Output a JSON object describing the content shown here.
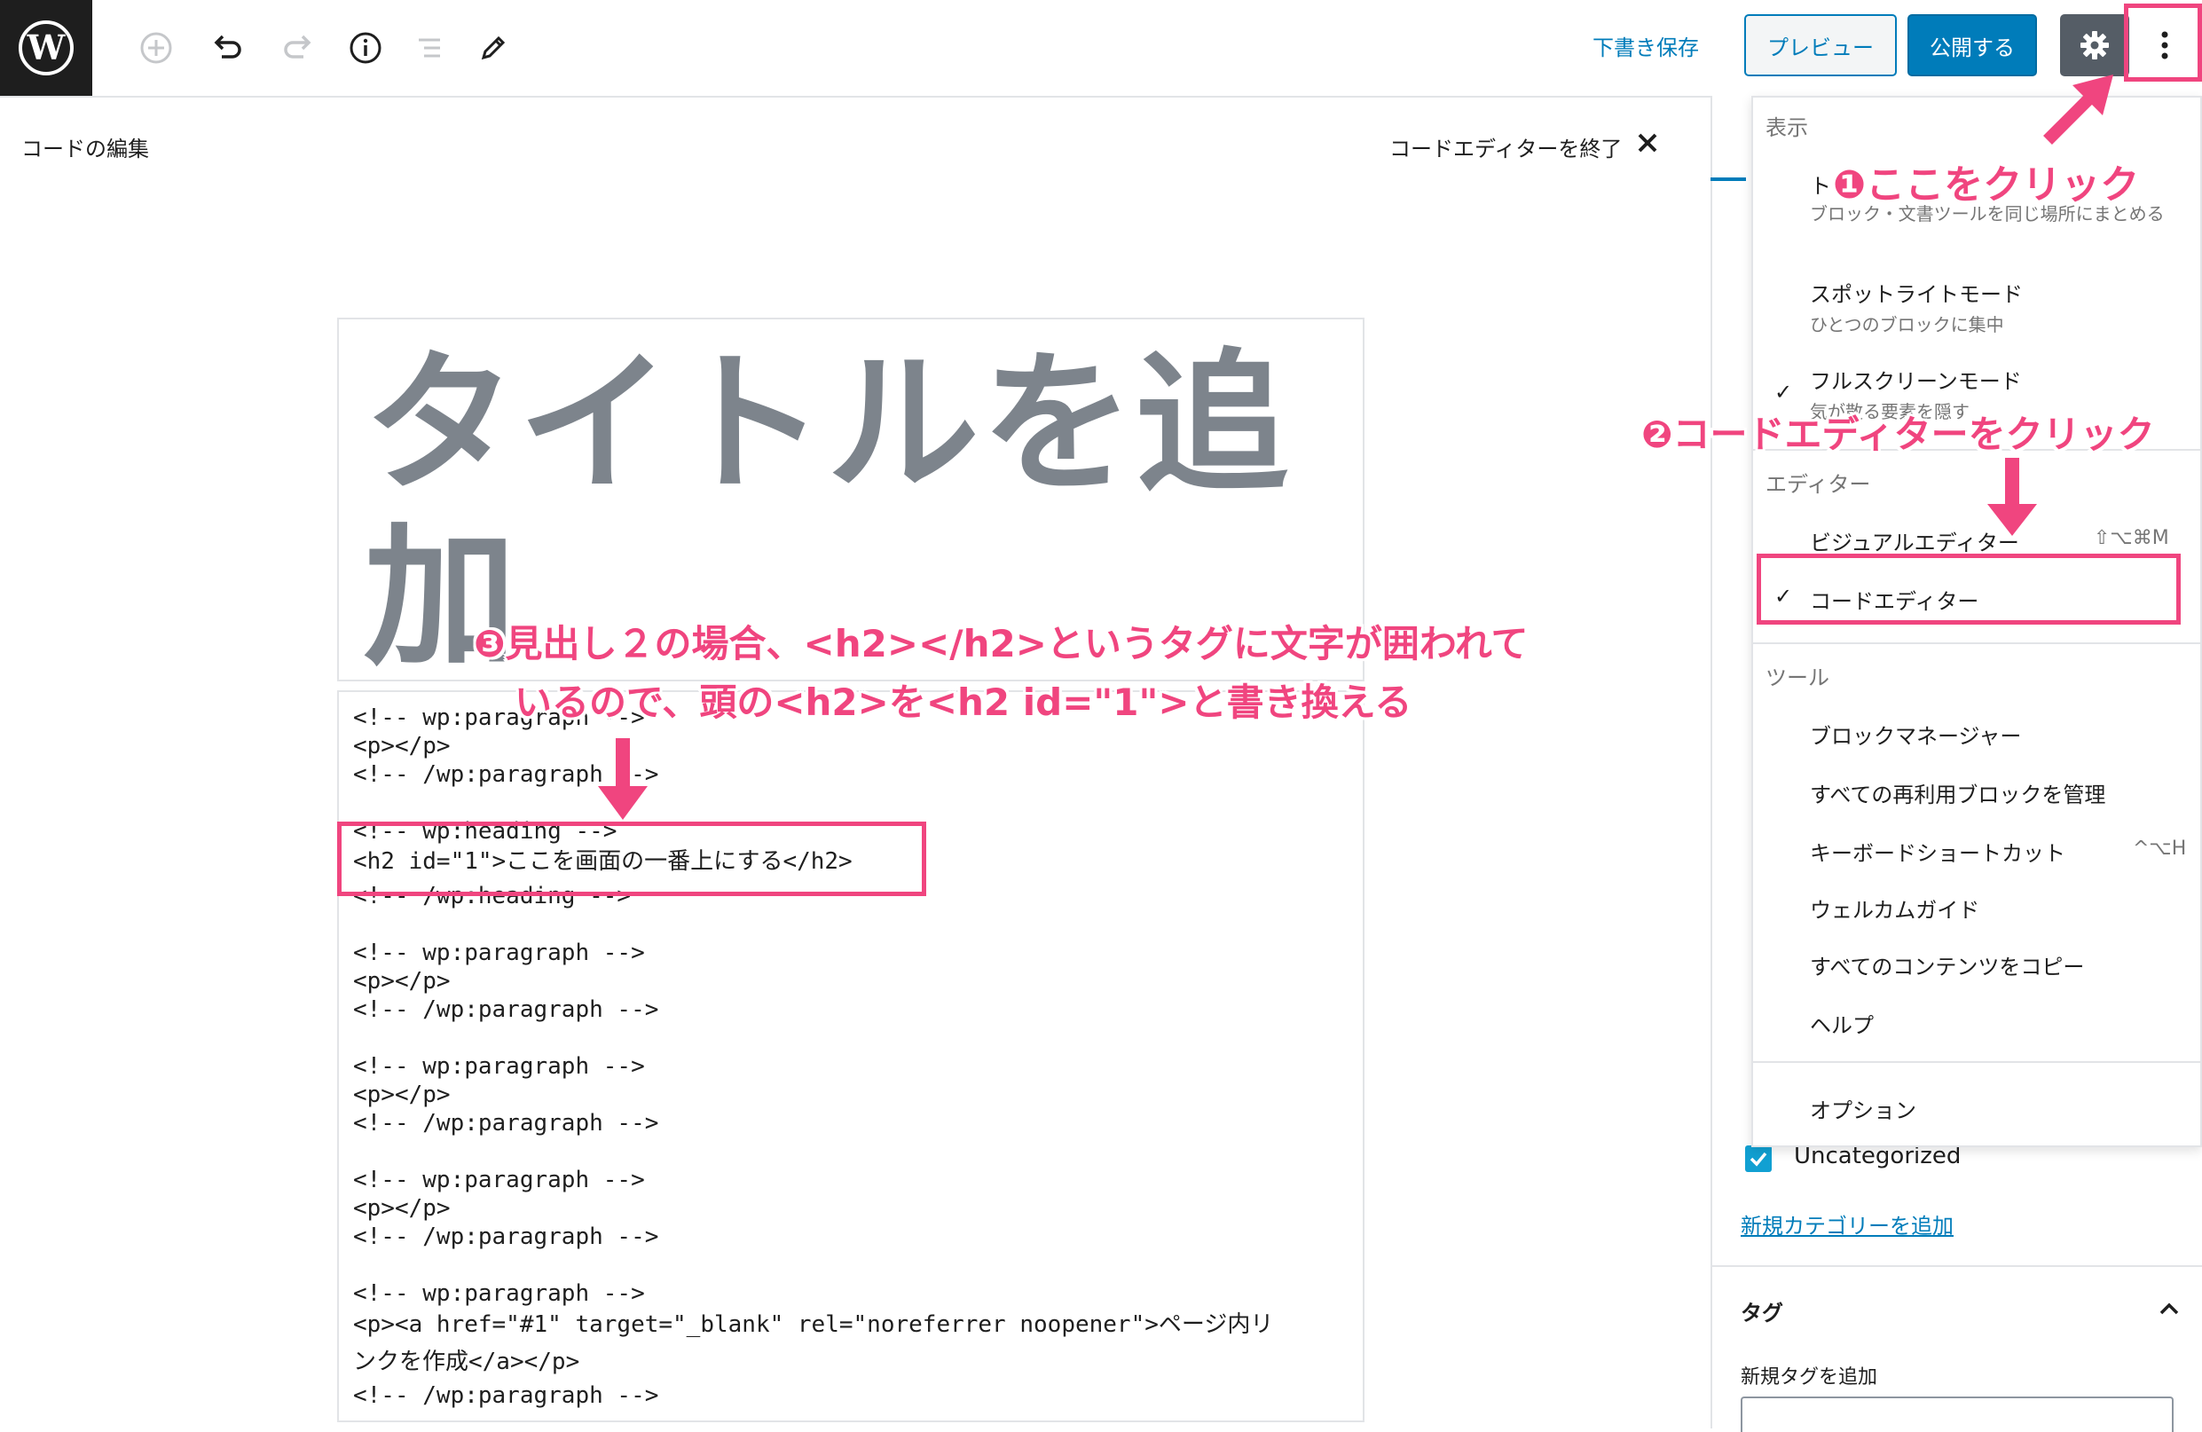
{
  "toolbar": {
    "save_draft": "下書き保存",
    "preview": "プレビュー",
    "publish": "公開する"
  },
  "code_editor_header": {
    "title": "コードの編集",
    "exit": "コードエディターを終了"
  },
  "editor": {
    "title_placeholder": "タイトルを追加",
    "code_lines": [
      "<!-- wp:paragraph -->",
      "<p></p>",
      "<!-- /wp:paragraph -->",
      "<!-- wp:heading -->",
      "<h2 id=\"1\">ここを画面の一番上にする</h2>",
      "<!-- /wp:heading -->",
      "<!-- wp:paragraph -->",
      "<p></p>",
      "<!-- /wp:paragraph -->",
      "<!-- wp:paragraph -->",
      "<p></p>",
      "<!-- /wp:paragraph -->",
      "<!-- wp:paragraph -->",
      "<p></p>",
      "<!-- /wp:paragraph -->",
      "<!-- wp:paragraph -->",
      "<p><a href=\"#1\" target=\"_blank\" rel=\"noreferrer noopener\">ページ内リ",
      "ンクを作成</a></p>",
      "<!-- /wp:paragraph -->"
    ]
  },
  "dropdown": {
    "view_group": "表示",
    "top_toolbar_label": "ト",
    "top_toolbar_desc": "ブロック・文書ツールを同じ場所にまとめる",
    "spotlight_label": "スポットライトモード",
    "spotlight_desc": "ひとつのブロックに集中",
    "fullscreen_label": "フルスクリーンモード",
    "fullscreen_desc": "気が散る要素を隠す",
    "editor_group": "エディター",
    "visual_editor": "ビジュアルエディター",
    "visual_shortcut": "⇧⌥⌘M",
    "code_editor": "コードエディター",
    "tools_group": "ツール",
    "block_manager": "ブロックマネージャー",
    "manage_reusable": "すべての再利用ブロックを管理",
    "keyboard_shortcuts": "キーボードショートカット",
    "keyboard_shortcut_key": "^⌥H",
    "welcome_guide": "ウェルカムガイド",
    "copy_all": "すべてのコンテンツをコピー",
    "help": "ヘルプ",
    "options": "オプション"
  },
  "sidebar": {
    "category_uncategorized": "Uncategorized",
    "add_category": "新規カテゴリーを追加",
    "tags_title": "タグ",
    "add_tag_label": "新規タグを追加"
  },
  "annotations": {
    "step1": "❶ここをクリック",
    "step2": "❷コードエディターをクリック",
    "step3_line1": "❸見出し２の場合、<h2></h2>というタグに文字が囲われて",
    "step3_line2": "いるので、頭の<h2>を<h2 id=\"1\">と書き換える"
  },
  "colors": {
    "accent": "#007cba",
    "annotation": "#f0457f",
    "title_gray": "#7d848c"
  }
}
